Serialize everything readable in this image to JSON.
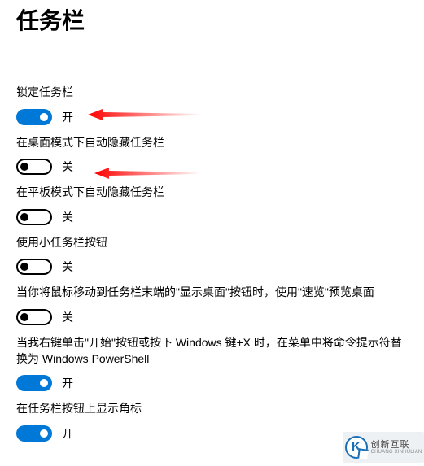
{
  "page": {
    "title": "任务栏"
  },
  "state": {
    "on": "开",
    "off": "关"
  },
  "settings": [
    {
      "key": "lock",
      "label": "锁定任务栏",
      "value": true
    },
    {
      "key": "autohide_dm",
      "label": "在桌面模式下自动隐藏任务栏",
      "value": false
    },
    {
      "key": "autohide_tm",
      "label": "在平板模式下自动隐藏任务栏",
      "value": false
    },
    {
      "key": "small_btn",
      "label": "使用小任务栏按钮",
      "value": false
    },
    {
      "key": "peek",
      "label": "当你将鼠标移动到任务栏末端的\"显示桌面\"按钮时，使用\"速览\"预览桌面",
      "value": false
    },
    {
      "key": "powershell",
      "label": "当我右键单击\"开始\"按钮或按下 Windows 键+X 时，在菜单中将命令提示符替换为 Windows PowerShell",
      "value": true
    },
    {
      "key": "badges",
      "label": "在任务栏按钮上显示角标",
      "value": true
    }
  ],
  "watermark": {
    "zh": "创新互联",
    "en": "CHUANG XINHULIAN",
    "glyph": "K"
  },
  "annotation": {
    "arrow_color": "#ff0000"
  }
}
